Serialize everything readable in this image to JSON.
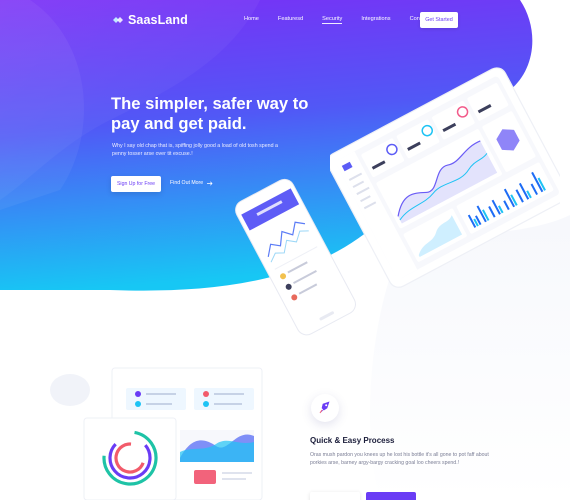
{
  "brand": {
    "name": "SaasLand"
  },
  "nav": {
    "items": [
      {
        "label": "Home"
      },
      {
        "label": "Featuresd"
      },
      {
        "label": "Security"
      },
      {
        "label": "Integrations"
      },
      {
        "label": "Contact Us"
      }
    ],
    "cta_label": "Get Started"
  },
  "hero": {
    "title": "The simpler, safer way to pay and get paid.",
    "text": "Why I say old chap that is, spiffing jolly good a load of old tosh spend a penny tosser arse over tit excuse.!",
    "primary_label": "Sign Up for Free",
    "secondary_label": "Find Out More"
  },
  "feature": {
    "title": "Quick & Easy Process",
    "text": "Oras mush pardon you knees up he lost his bottle it's all gone to pot faff about porkies arse, barney argy-bargy cracking goal loo cheers spend.!"
  },
  "colors": {
    "gradient_top": "#7b2ff7",
    "gradient_mid": "#4f5bf5",
    "gradient_bottom": "#1ec3f4",
    "accent": "#6a3cf5"
  },
  "icons": [
    "logo-icon",
    "arrow-right-icon",
    "rocket-icon"
  ]
}
